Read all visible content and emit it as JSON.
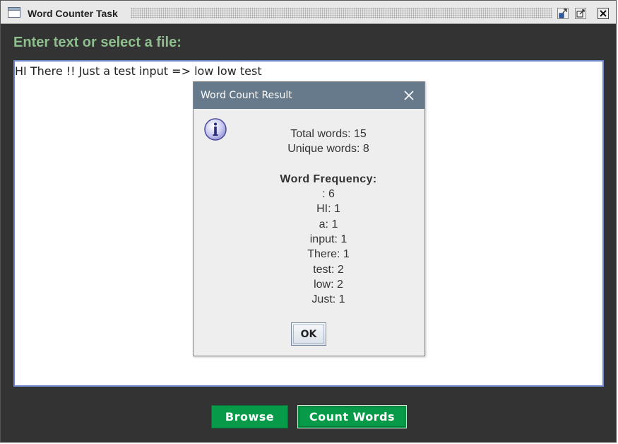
{
  "window": {
    "title": "Word Counter Task",
    "app_icon": "window-icon",
    "controls": [
      "minimize-icon",
      "maximize-icon",
      "close-icon"
    ]
  },
  "main": {
    "prompt_label": "Enter text or select a file:",
    "text_area_value": "HI There !! Just a test input => low low test"
  },
  "buttons": {
    "browse_label": "Browse",
    "count_label": "Count Words"
  },
  "dialog": {
    "title": "Word Count Result",
    "icon": "info-icon",
    "total_words": "Total words: 15",
    "unique_words": "Unique words: 8",
    "frequency_heading": "Word Frequency:",
    "frequencies": [
      ": 6",
      "HI: 1",
      "a: 1",
      "input: 1",
      "There: 1",
      "test: 2",
      "low: 2",
      "Just: 1"
    ],
    "ok_label": "OK"
  },
  "colors": {
    "window_bg": "#333333",
    "prompt_color": "#8fbf8f",
    "button_green": "#079a48",
    "dialog_titlebar": "#677a8c",
    "text_area_border": "#6b87c7"
  }
}
